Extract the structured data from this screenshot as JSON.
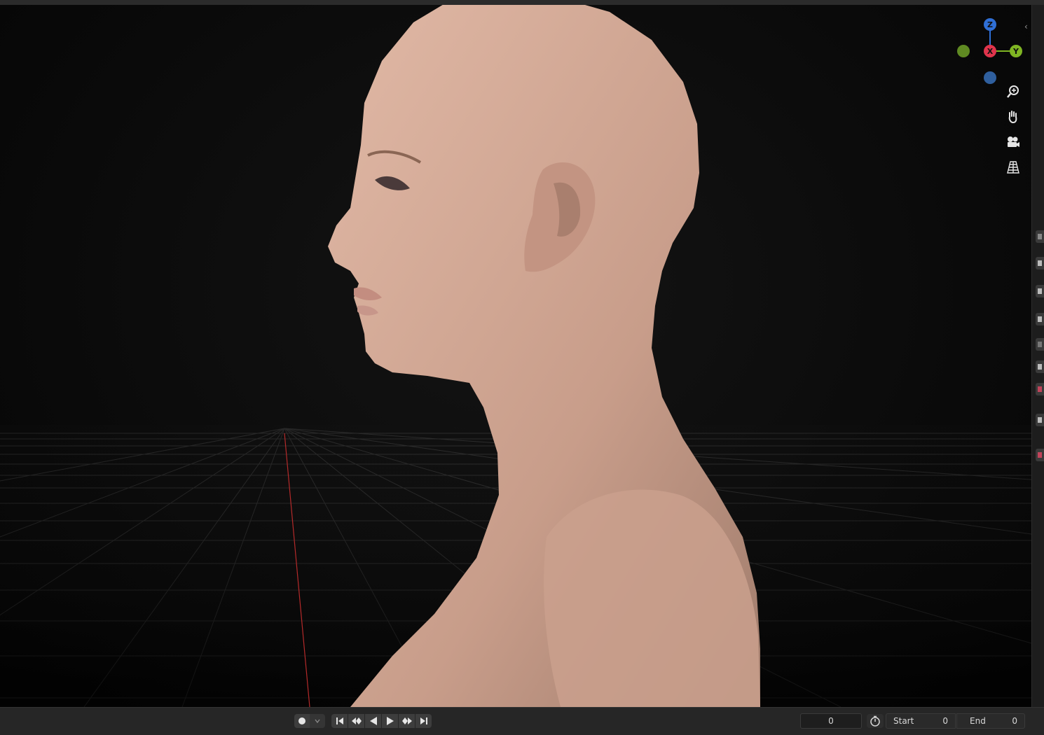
{
  "viewport": {
    "gizmo": {
      "axis_z": "Z",
      "axis_x": "X",
      "axis_y": "Y",
      "color_z": "#2f6fd6",
      "color_x": "#e0344c",
      "color_y": "#7fb523",
      "color_neg_y": "#5f8a22",
      "color_neg_z": "#2f5f9e"
    },
    "nav_buttons": [
      "zoom-icon",
      "hand-pan-icon",
      "camera-icon",
      "perspective-grid-icon"
    ],
    "collapse_icon": "chevron-left-icon"
  },
  "timeline": {
    "current_frame": "0",
    "start_label": "Start",
    "start_value": "0",
    "end_label": "End",
    "end_value": "0",
    "record_icon": "record-dot-icon",
    "playback_icons": [
      "jump-start-icon",
      "prev-keyframe-icon",
      "play-reverse-icon",
      "play-icon",
      "next-keyframe-icon",
      "jump-end-icon"
    ],
    "stopwatch_icon": "stopwatch-icon"
  }
}
